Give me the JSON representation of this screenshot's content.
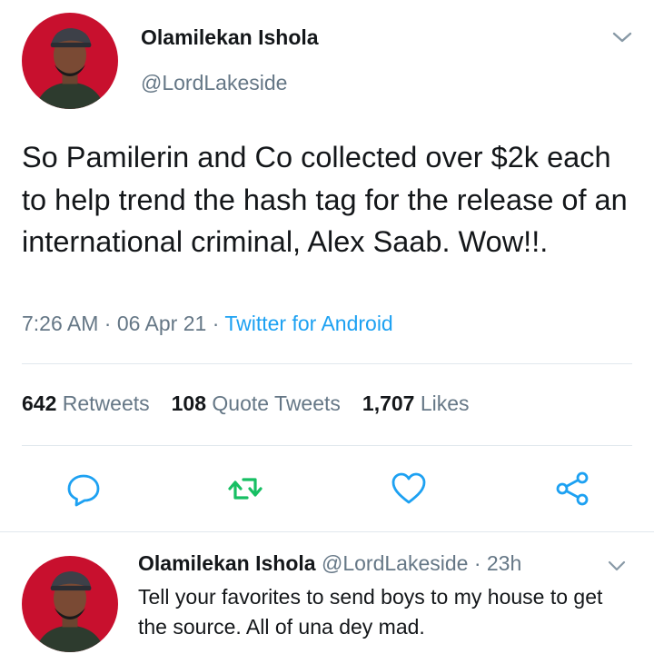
{
  "tweet": {
    "author_name": "Olamilekan Ishola",
    "author_handle": "@LordLakeside",
    "text": "So Pamilerin and Co collected over $2k each to help trend the hash tag for the release of an international criminal, Alex Saab. Wow!!.",
    "time": "7:26 AM",
    "date": "06 Apr 21",
    "separator": "·",
    "source": "Twitter for Android",
    "stats": {
      "retweets_count": "642",
      "retweets_label": "Retweets",
      "quote_tweets_count": "108",
      "quote_tweets_label": "Quote Tweets",
      "likes_count": "1,707",
      "likes_label": "Likes"
    },
    "actions": [
      "reply-icon",
      "retweet-icon",
      "like-icon",
      "share-icon"
    ]
  },
  "reply": {
    "author_name": "Olamilekan Ishola",
    "author_handle": "@LordLakeside",
    "separator": "·",
    "age": "23h",
    "text": "Tell your favorites to send boys to my house to get the source. All of una dey mad."
  },
  "colors": {
    "accent": "#1da1f2",
    "retweet": "#17bf63",
    "secondary_text": "#657786",
    "icon": "#1da1f2",
    "avatar_background": "#c8102e"
  }
}
